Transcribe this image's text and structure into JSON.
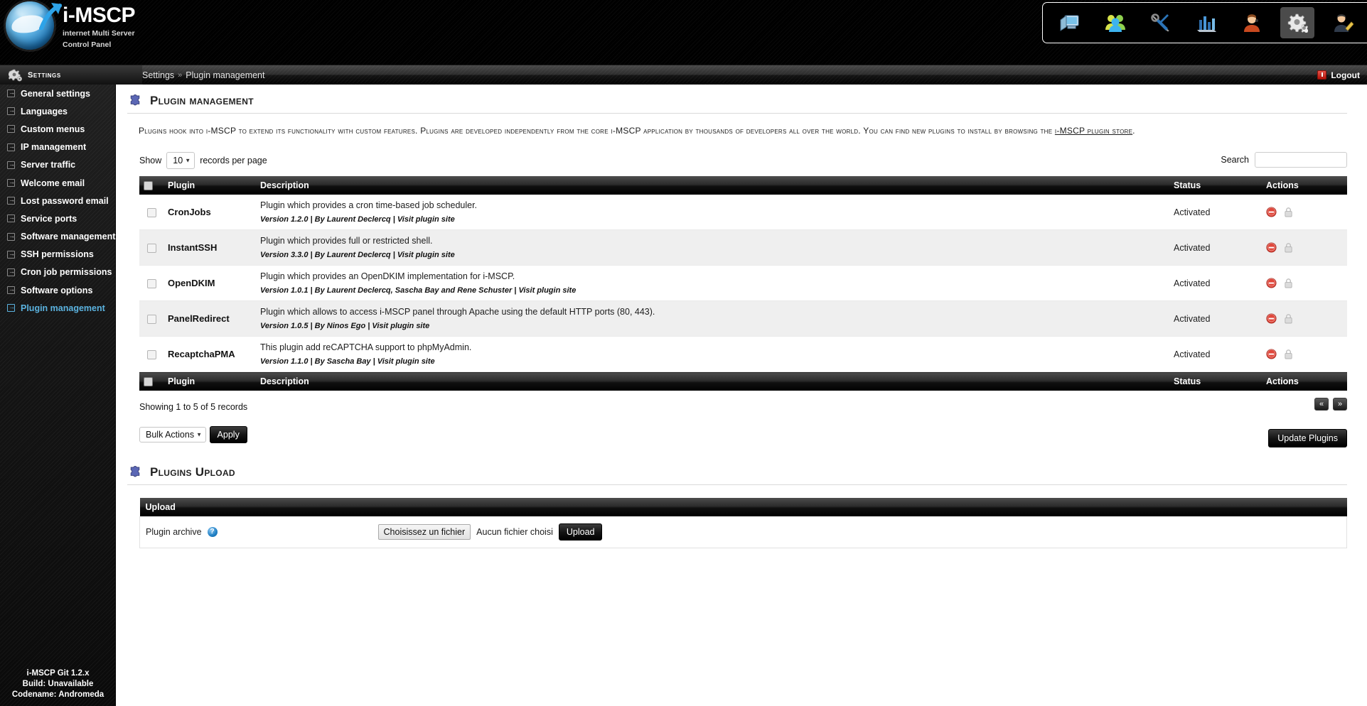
{
  "brand": {
    "title": "i-MSCP",
    "subtitle_line1": "internet Multi Server",
    "subtitle_line2": "Control Panel"
  },
  "topnav": [
    {
      "name": "general-information-icon",
      "label": "General information"
    },
    {
      "name": "users-icon",
      "label": "Users"
    },
    {
      "name": "tools-icon",
      "label": "System tools"
    },
    {
      "name": "statistics-icon",
      "label": "Statistics"
    },
    {
      "name": "support-icon",
      "label": "Support"
    },
    {
      "name": "settings-icon",
      "label": "Settings"
    },
    {
      "name": "profile-icon",
      "label": "Profile"
    }
  ],
  "topnav_active_index": 5,
  "bcbar": {
    "section_label": "Settings",
    "breadcrumb_root": "Settings",
    "breadcrumb_sep": "»",
    "breadcrumb_current": "Plugin management",
    "logout_label": "Logout"
  },
  "sidebar": {
    "items": [
      {
        "label": "General settings",
        "active": false
      },
      {
        "label": "Languages",
        "active": false
      },
      {
        "label": "Custom menus",
        "active": false
      },
      {
        "label": "IP management",
        "active": false
      },
      {
        "label": "Server traffic",
        "active": false
      },
      {
        "label": "Welcome email",
        "active": false
      },
      {
        "label": "Lost password email",
        "active": false
      },
      {
        "label": "Service ports",
        "active": false
      },
      {
        "label": "Software management",
        "active": false
      },
      {
        "label": "SSH permissions",
        "active": false
      },
      {
        "label": "Cron job permissions",
        "active": false
      },
      {
        "label": "Software options",
        "active": false
      },
      {
        "label": "Plugin management",
        "active": true
      }
    ],
    "version_line1": "i-MSCP Git 1.2.x",
    "version_line2": "Build: Unavailable",
    "version_line3": "Codename: Andromeda"
  },
  "page": {
    "title": "Plugin management",
    "description_before_link": "Plugins hook into i-MSCP to extend its functionality with custom features. Plugins are developed independently from the core i-MSCP application by thousands of developers all over the world. You can find new plugins to install by browsing the ",
    "description_link": "i-MSCP plugin store",
    "description_after_link": "."
  },
  "toolbar": {
    "show_label": "Show",
    "records_per_page_value": "10",
    "records_per_page_suffix": "records per page",
    "search_label": "Search",
    "search_value": "",
    "search_placeholder": ""
  },
  "table": {
    "headers": {
      "plugin": "Plugin",
      "description": "Description",
      "status": "Status",
      "actions": "Actions"
    },
    "rows": [
      {
        "name": "CronJobs",
        "description": "Plugin which provides a cron time-based job scheduler.",
        "version": "Version 1.2.0",
        "author": "By Laurent Declercq",
        "site": "Visit plugin site",
        "status": "Activated",
        "checked": false
      },
      {
        "name": "InstantSSH",
        "description": "Plugin which provides full or restricted shell.",
        "version": "Version 3.3.0",
        "author": "By Laurent Declercq",
        "site": "Visit plugin site",
        "status": "Activated",
        "checked": false
      },
      {
        "name": "OpenDKIM",
        "description": "Plugin which provides an OpenDKIM implementation for i-MSCP.",
        "version": "Version 1.0.1",
        "author": "By Laurent Declercq, Sascha Bay and Rene Schuster",
        "site": "Visit plugin site",
        "status": "Activated",
        "checked": false
      },
      {
        "name": "PanelRedirect",
        "description": "Plugin which allows to access i-MSCP panel through Apache using the default HTTP ports (80, 443).",
        "version": "Version 1.0.5",
        "author": "By Ninos Ego",
        "site": "Visit plugin site",
        "status": "Activated",
        "checked": false
      },
      {
        "name": "RecaptchaPMA",
        "description": "This plugin add reCAPTCHA support to phpMyAdmin.",
        "version": "Version 1.1.0",
        "author": "By Sascha Bay",
        "site": "Visit plugin site",
        "status": "Activated",
        "checked": false
      }
    ],
    "meta_sep": "|",
    "action_icons": [
      {
        "name": "deactivate-icon",
        "title": "Deactivate"
      },
      {
        "name": "lock-icon",
        "title": "Protect"
      }
    ]
  },
  "footer": {
    "showing": "Showing 1 to 5 of 5 records",
    "pager_first": "«",
    "pager_last": "»",
    "bulk_actions_value": "Bulk Actions",
    "apply_label": "Apply",
    "update_plugins_label": "Update Plugins"
  },
  "upload": {
    "section_title": "Plugins Upload",
    "table_header": "Upload",
    "field_label": "Plugin archive",
    "help_glyph": "?",
    "choose_file_label": "Choisissez un fichier",
    "no_file_label": "Aucun fichier choisi",
    "upload_button_label": "Upload"
  },
  "colors": {
    "accent_active": "#5bb3e0",
    "header_black": "#000000",
    "row_alt": "#efefef",
    "deactivate_red": "#dd3b30"
  }
}
